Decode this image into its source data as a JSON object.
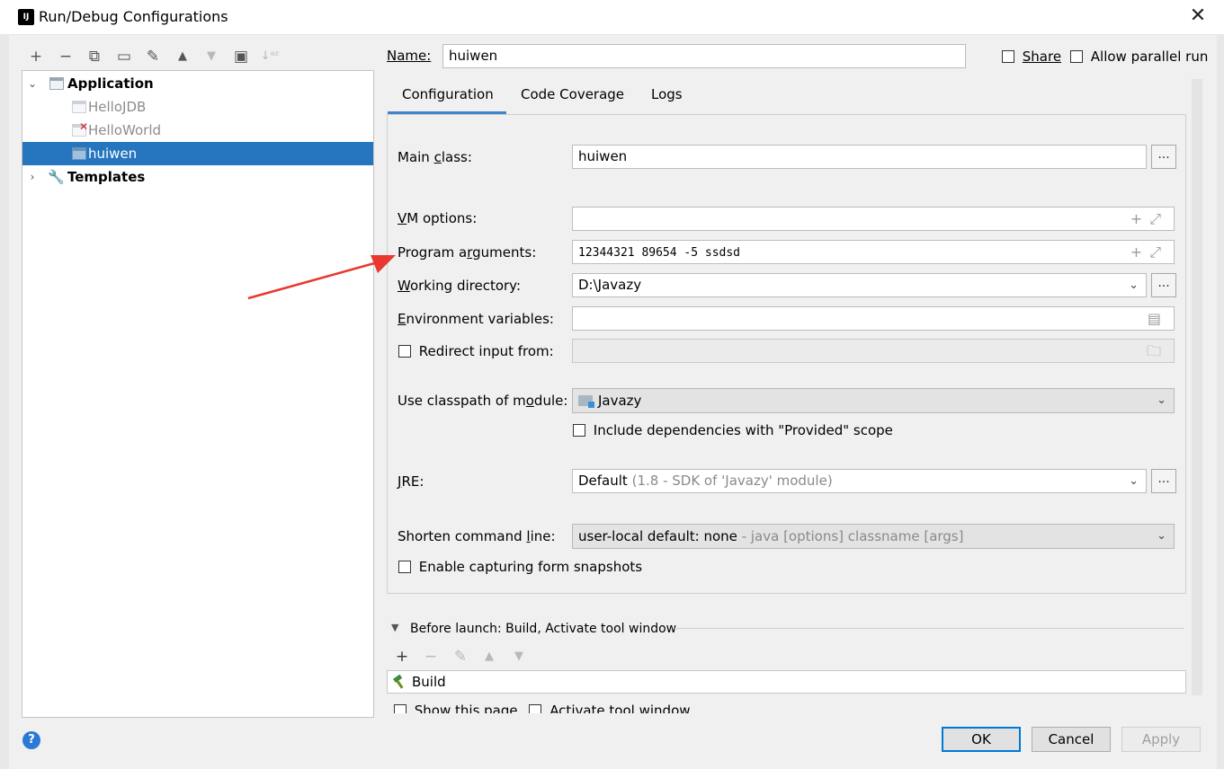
{
  "window": {
    "title": "Run/Debug Configurations",
    "app_icon_text": "IJ"
  },
  "toolbar": {
    "add": "+",
    "remove": "−",
    "copy": "⧉",
    "save": "▭",
    "edit": "✎",
    "up": "▲",
    "down": "▼",
    "folder": "▣",
    "sort": "↓ᵃᶻ"
  },
  "tree": {
    "application": "Application",
    "items": [
      "HelloJDB",
      "HelloWorld",
      "huiwen"
    ],
    "templates": "Templates"
  },
  "name": {
    "label": "Name:",
    "value": "huiwen"
  },
  "share": {
    "label": "Share",
    "checked": false
  },
  "parallel": {
    "label": "Allow parallel run",
    "checked": false
  },
  "tabs": [
    "Configuration",
    "Code Coverage",
    "Logs"
  ],
  "form": {
    "main_class_label": "Main class:",
    "main_class": "huiwen",
    "vm_options_label": "VM options:",
    "vm_options": "",
    "program_args_label": "Program arguments:",
    "program_args": "12344321 89654 -5 ssdsd",
    "working_dir_label": "Working directory:",
    "working_dir": "D:\\Javazy",
    "env_vars_label": "Environment variables:",
    "env_vars": "",
    "redirect_label": "Redirect input from:",
    "classpath_label": "Use classpath of module:",
    "classpath_module": "Javazy",
    "include_deps_label": "Include dependencies with \"Provided\" scope",
    "jre_label": "JRE:",
    "jre_value": "Default",
    "jre_hint": "(1.8 - SDK of 'Javazy' module)",
    "shorten_label": "Shorten command line:",
    "shorten_value": "user-local default: none",
    "shorten_hint": "- java [options] classname [args]",
    "snapshots_label": "Enable capturing form snapshots"
  },
  "before_launch": {
    "title": "Before launch: Build, Activate tool window",
    "item": "Build",
    "show_page": "Show this page",
    "activate": "Activate tool window"
  },
  "buttons": {
    "ok": "OK",
    "cancel": "Cancel",
    "apply": "Apply",
    "help": "?"
  },
  "colors": {
    "selection": "#2675bf",
    "accent": "#4083c9",
    "arrow": "#e8382f"
  }
}
